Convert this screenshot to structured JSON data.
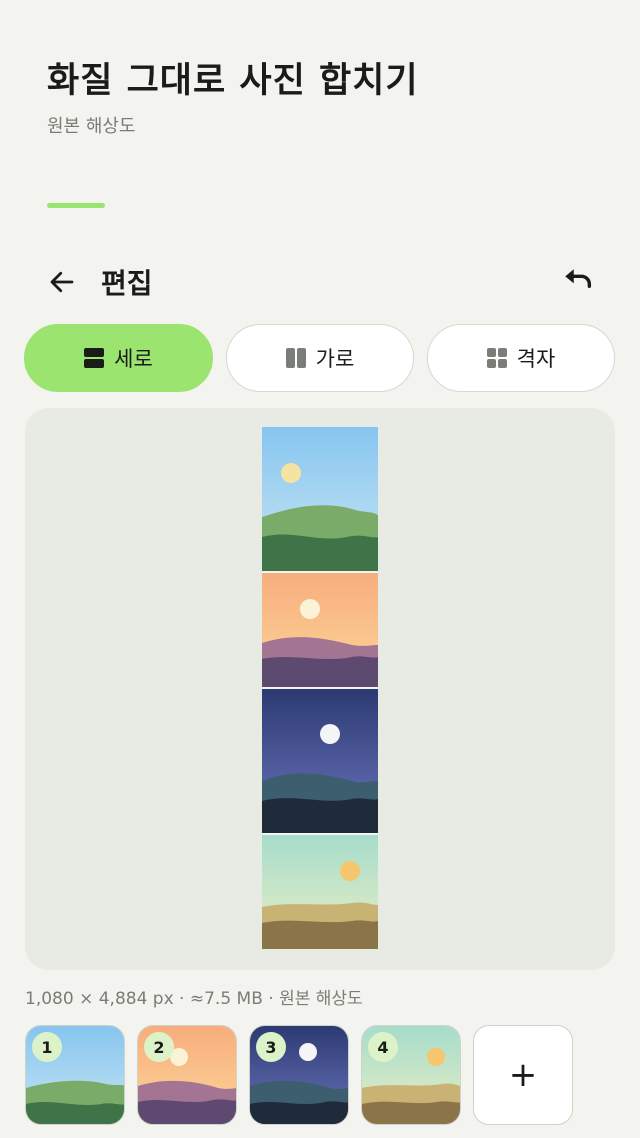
{
  "header": {
    "title": "화질 그대로 사진 합치기",
    "subtitle": "원본 해상도",
    "progress_fraction": 0.12
  },
  "editor": {
    "title": "편집",
    "back_icon": "arrow-left-icon",
    "undo_icon": "undo-icon"
  },
  "layouts": [
    {
      "label": "세로",
      "icon": "vertical-layout-icon",
      "active": true
    },
    {
      "label": "가로",
      "icon": "horizontal-layout-icon",
      "active": false
    },
    {
      "label": "격자",
      "icon": "grid-layout-icon",
      "active": false
    }
  ],
  "info": {
    "text": "1,080 × 4,884 px · ≈7.5 MB · 원본 해상도"
  },
  "thumbnails": [
    {
      "number": "1",
      "scene": "daytime-hills"
    },
    {
      "number": "2",
      "scene": "sunset-hills"
    },
    {
      "number": "3",
      "scene": "night-moon-hills"
    },
    {
      "number": "4",
      "scene": "desert-dunes"
    }
  ],
  "add_button": {
    "label": "+"
  },
  "colors": {
    "accent": "#9be46f",
    "background": "#f3f4ef",
    "preview_bg": "#e8eae4"
  }
}
